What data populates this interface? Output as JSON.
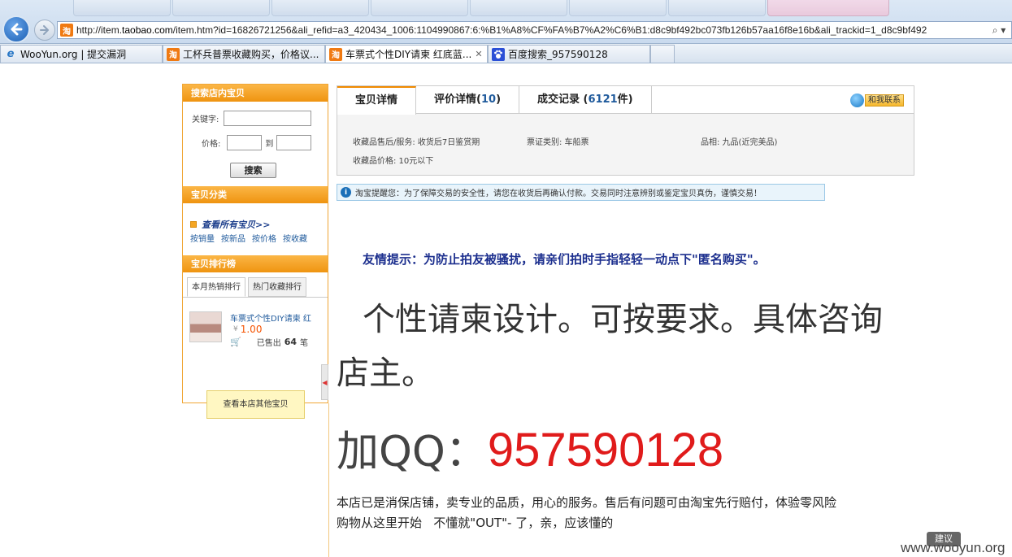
{
  "browser": {
    "url_prefix": "http://item.",
    "url_host": "taobao.com",
    "url_rest": "/item.htm?id=16826721256&ali_refid=a3_420434_1006:1104990867:6:%B1%A8%CF%FA%B7%A2%C6%B1:d8c9bf492bc073fb126b57aa16f8e16b&ali_trackid=1_d8c9bf492",
    "tabs": [
      {
        "label": "WooYun.org | 提交漏洞",
        "icon": "ie-icon"
      },
      {
        "label": "工杯兵普票收藏购买，价格议...",
        "icon": "taobao-icon"
      },
      {
        "label": "车票式个性DIY请柬 红底蓝...",
        "icon": "taobao-icon",
        "active": true
      },
      {
        "label": "百度搜索_957590128",
        "icon": "baidu-icon"
      }
    ],
    "close_glyph": "✕",
    "taobao_glyph": "淘",
    "search_glyph": "⌕ ▾"
  },
  "sidebar": {
    "search_title": "搜索店内宝贝",
    "keyword_label": "关键字:",
    "price_label": "价格:",
    "to_label": "到",
    "search_button": "搜索",
    "category_title": "宝贝分类",
    "view_all": "查看所有宝贝>>",
    "sort_links": [
      "按销量",
      "按新品",
      "按价格",
      "按收藏"
    ],
    "rank_title": "宝贝排行榜",
    "rank_tabs": [
      "本月热销排行",
      "热门收藏排行"
    ],
    "rank_item": {
      "title": "车票式个性DIY请柬 红",
      "price": "1.00",
      "sold_label": "已售出",
      "sold_count": "64",
      "sold_unit": "笔"
    },
    "more_button": "查看本店其他宝贝"
  },
  "detail": {
    "tabs": [
      {
        "label": "宝贝详情",
        "num": "",
        "suffix": ""
      },
      {
        "label": "评价详情(",
        "num": "10",
        "suffix": ")"
      },
      {
        "label": "成交记录 (",
        "num": "6121",
        "suffix": "件)"
      }
    ],
    "contact": "和我联系",
    "attrs": {
      "after_sale": "收藏品售后/服务: 收货后7日鉴赏期",
      "ticket_type": "票证类别: 车船票",
      "condition": "品相: 九品(近完美品)",
      "price_range": "收藏品价格: 10元以下"
    }
  },
  "notice": "淘宝提醒您：为了保障交易的安全性，请您在收货后再确认付款。交易同时注意辨别或鉴定宝贝真伪，谨慎交易！",
  "content": {
    "tip": "友情提示：为防止拍友被骚扰，请亲们拍时手指轻轻一动点下\"匿名购买\"。",
    "headline": "个性请柬设计。可按要求。具体咨询店主。",
    "qq_prefix": "加QQ：",
    "qq_number": "957590128",
    "para_line1": "本店已是消保店铺，卖专业的品质，用心的服务。售后有问题可由淘宝先行赔付，体验零风险",
    "para_line2": "购物从这里开始   不懂就\"OUT\"- 了，亲，应该懂的"
  },
  "footer": {
    "feedback": "建议",
    "watermark": "www.wooyun.org"
  },
  "colors": {
    "accent_orange": "#f0a636",
    "qq_red": "#e01b1b",
    "tip_blue": "#1c2f8e"
  }
}
